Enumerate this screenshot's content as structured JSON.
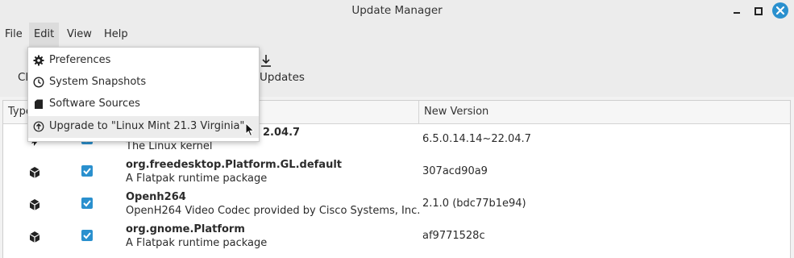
{
  "window": {
    "title": "Update Manager"
  },
  "menubar": {
    "items": [
      "File",
      "Edit",
      "View",
      "Help"
    ]
  },
  "toolbar": {
    "left_label_fragment": "Cl",
    "updates_label": "Updates"
  },
  "edit_menu": {
    "items": [
      {
        "label": "Preferences",
        "icon": "gear-icon"
      },
      {
        "label": "System Snapshots",
        "icon": "clock-icon"
      },
      {
        "label": "Software Sources",
        "icon": "package-icon"
      },
      {
        "label": "Upgrade to \"Linux Mint 21.3 Virginia\"",
        "icon": "upgrade-icon"
      }
    ]
  },
  "table": {
    "columns": {
      "type": "Type",
      "new_version": "New Version"
    },
    "rows": [
      {
        "name": "2.04.7",
        "desc": "The Linux kernel",
        "version": "6.5.0.14.14~22.04.7",
        "checked": true,
        "icon": "kernel-icon"
      },
      {
        "name": "org.freedesktop.Platform.GL.default",
        "desc": "A Flatpak runtime package",
        "version": "307acd90a9",
        "checked": true,
        "icon": "flatpak-package-icon"
      },
      {
        "name": "Openh264",
        "desc": "OpenH264 Video Codec provided by Cisco Systems, Inc.",
        "version": "2.1.0 (bdc77b1e94)",
        "checked": true,
        "icon": "flatpak-package-icon"
      },
      {
        "name": "org.gnome.Platform",
        "desc": "A Flatpak runtime package",
        "version": "af9771528c",
        "checked": true,
        "icon": "flatpak-package-icon"
      }
    ]
  },
  "colors": {
    "accent": "#2a90ce",
    "bg": "#ececec"
  }
}
